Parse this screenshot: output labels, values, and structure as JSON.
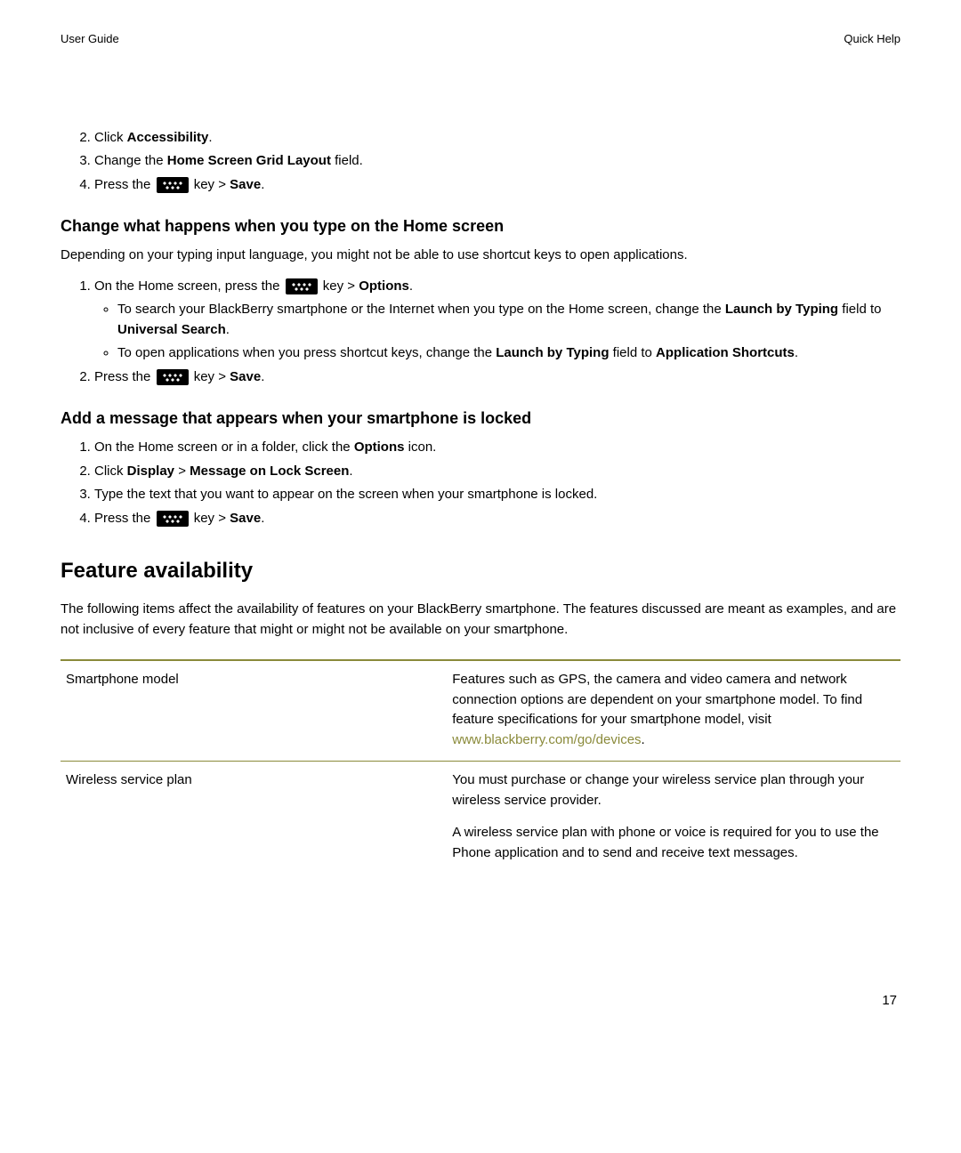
{
  "header": {
    "left": "User Guide",
    "right": "Quick Help"
  },
  "top": {
    "s2_a": "Click ",
    "s2_b": "Accessibility",
    "s2_c": ".",
    "s3_a": "Change the ",
    "s3_b": "Home Screen Grid Layout",
    "s3_c": " field.",
    "s4_a": "Press the ",
    "s4_b": " key > ",
    "s4_c": "Save",
    "s4_d": "."
  },
  "sec1": {
    "title": "Change what happens when you type on the Home screen",
    "intro": "Depending on your typing input language, you might not be able to use shortcut keys to open applications.",
    "s1_a": "On the Home screen, press the ",
    "s1_b": " key > ",
    "s1_c": "Options",
    "s1_d": ".",
    "b1_a": "To search your BlackBerry smartphone or the Internet when you type on the Home screen, change the ",
    "b1_b": "Launch by Typing",
    "b1_c": " field to ",
    "b1_d": "Universal Search",
    "b1_e": ".",
    "b2_a": "To open applications when you press shortcut keys, change the ",
    "b2_b": "Launch by Typing",
    "b2_c": " field to ",
    "b2_d": "Application Shortcuts",
    "b2_e": ".",
    "s2_a": "Press the ",
    "s2_b": " key > ",
    "s2_c": "Save",
    "s2_d": "."
  },
  "sec2": {
    "title": "Add a message that appears when your smartphone is locked",
    "s1_a": "On the Home screen or in a folder, click the ",
    "s1_b": "Options",
    "s1_c": " icon.",
    "s2_a": "Click ",
    "s2_b": "Display",
    "s2_c": " > ",
    "s2_d": "Message on Lock Screen",
    "s2_e": ".",
    "s3": "Type the text that you want to appear on the screen when your smartphone is locked.",
    "s4_a": "Press the ",
    "s4_b": " key > ",
    "s4_c": "Save",
    "s4_d": "."
  },
  "feature": {
    "heading": "Feature availability",
    "intro": "The following items affect the availability of features on your BlackBerry smartphone. The features discussed are meant as examples, and are not inclusive of every feature that might or might not be available on your smartphone.",
    "row1_label": "Smartphone model",
    "row1_a": "Features such as GPS, the camera and video camera and network connection options are dependent on your smartphone model. To find feature specifications for your smartphone model, visit ",
    "row1_link": "www.blackberry.com/go/devices",
    "row1_c": ".",
    "row2_label": "Wireless service plan",
    "row2_p1": "You must purchase or change your wireless service plan through your wireless service provider.",
    "row2_p2": "A wireless service plan with phone or voice is required for you to use the Phone application and to send and receive text messages."
  },
  "pagenum": "17"
}
